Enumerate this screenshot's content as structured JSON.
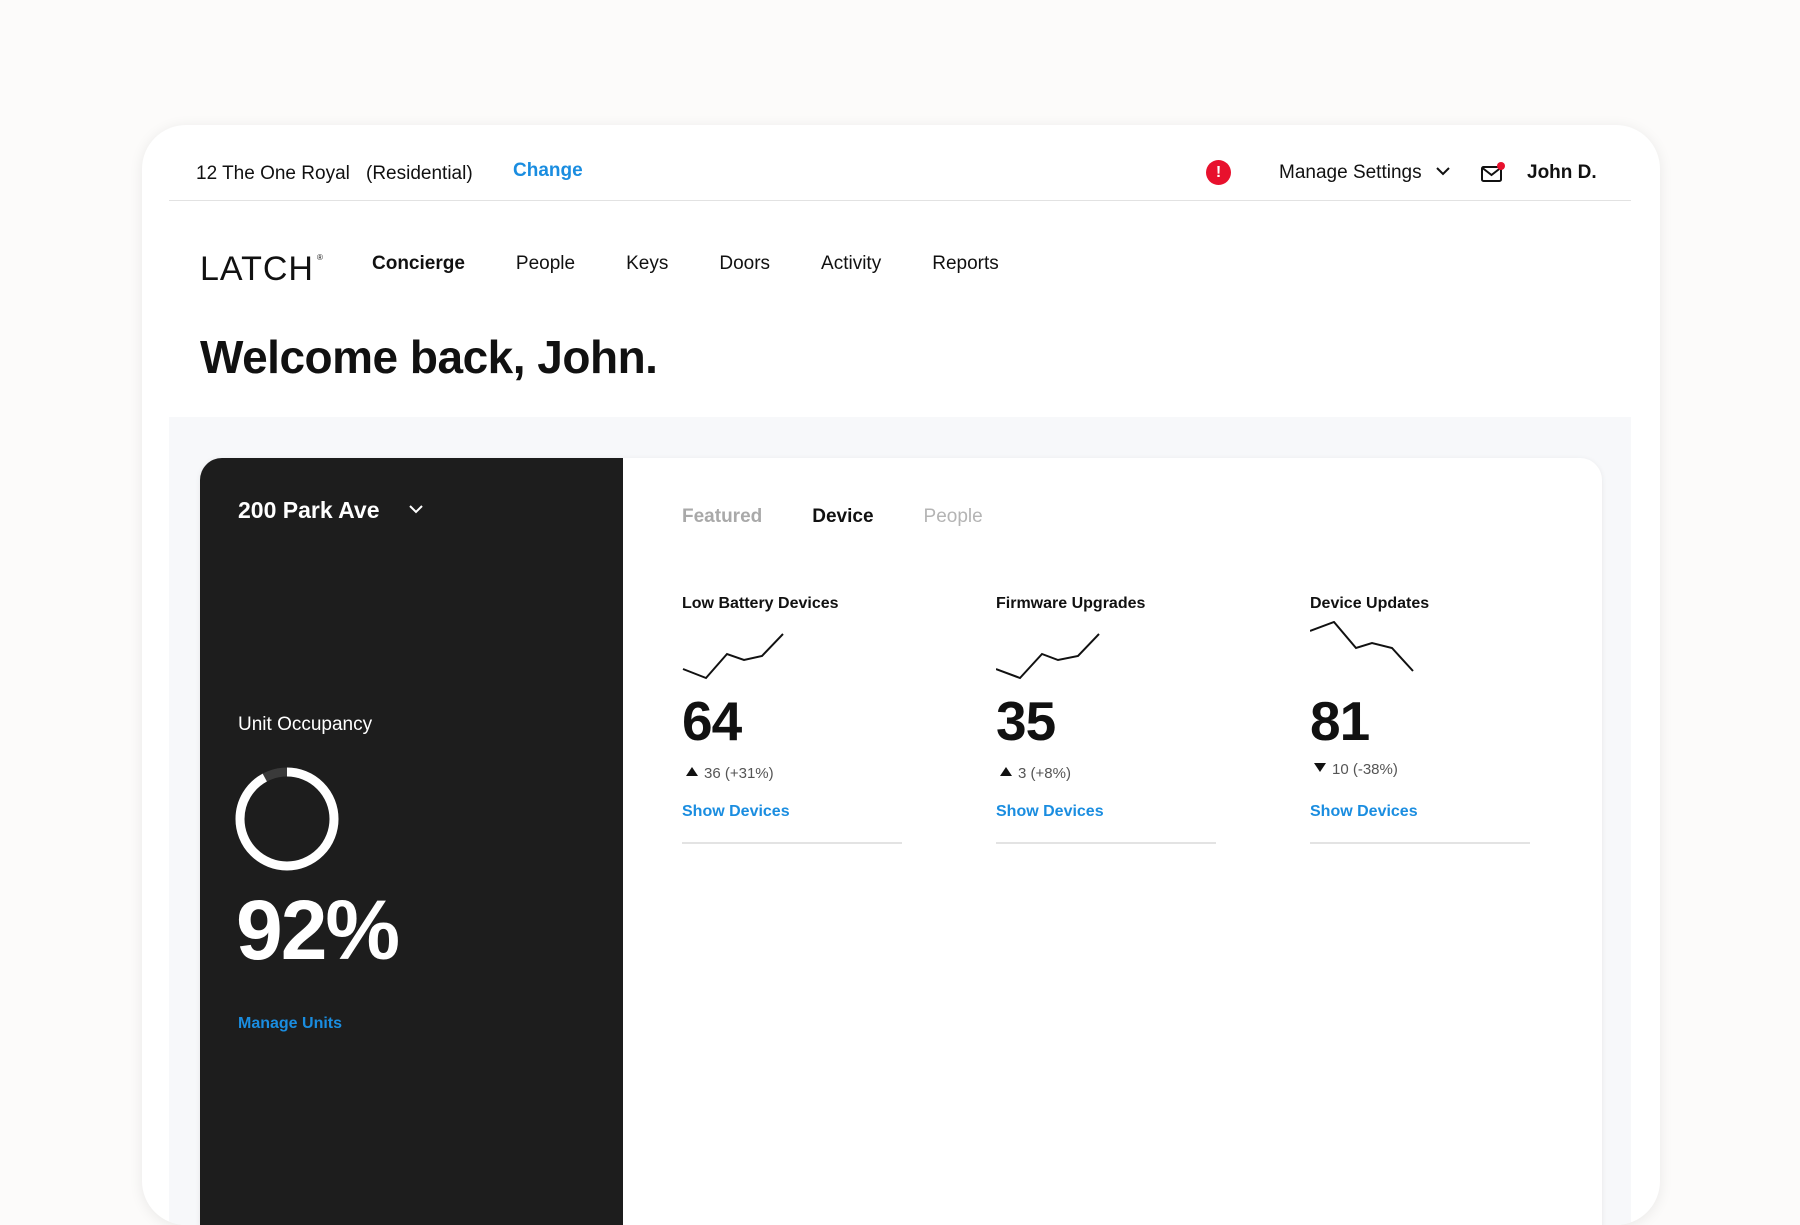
{
  "topbar": {
    "address": "12 The One Royal",
    "address_type": "(Residential)",
    "change_label": "Change",
    "alert_glyph": "!",
    "settings_label": "Manage Settings",
    "user_name": "John D."
  },
  "brand": {
    "logo_text": "LATCH",
    "registered_mark": "®"
  },
  "nav": {
    "items": [
      {
        "label": "Concierge",
        "active": true
      },
      {
        "label": "People"
      },
      {
        "label": "Keys"
      },
      {
        "label": "Doors"
      },
      {
        "label": "Activity"
      },
      {
        "label": "Reports"
      }
    ]
  },
  "welcome": "Welcome back, John.",
  "panel": {
    "building": "200 Park Ave",
    "occupancy_label": "Unit Occupancy",
    "occupancy_value": "92%",
    "occupancy_fraction": 0.92,
    "manage_units": "Manage Units"
  },
  "tabs": [
    {
      "label": "Featured"
    },
    {
      "label": "Device",
      "active": true
    },
    {
      "label": "People"
    }
  ],
  "metrics": [
    {
      "title": "Low Battery Devices",
      "value": "64",
      "direction": "up",
      "delta": "36 (+31%)",
      "link": "Show Devices"
    },
    {
      "title": "Firmware Upgrades",
      "value": "35",
      "direction": "up",
      "delta": "3 (+8%)",
      "link": "Show Devices"
    },
    {
      "title": "Device Updates",
      "value": "81",
      "direction": "down",
      "delta": "10 (-38%)",
      "link": "Show Devices"
    }
  ],
  "colors": {
    "accent": "#1a8de0",
    "alert": "#e8112d",
    "dark_panel": "#1d1d1d"
  },
  "icons": [
    "alert-icon",
    "chevron-down-icon",
    "mail-icon",
    "notification-dot-icon",
    "donut-chart-icon",
    "sparkline-icon",
    "triangle-up-icon",
    "triangle-down-icon"
  ]
}
